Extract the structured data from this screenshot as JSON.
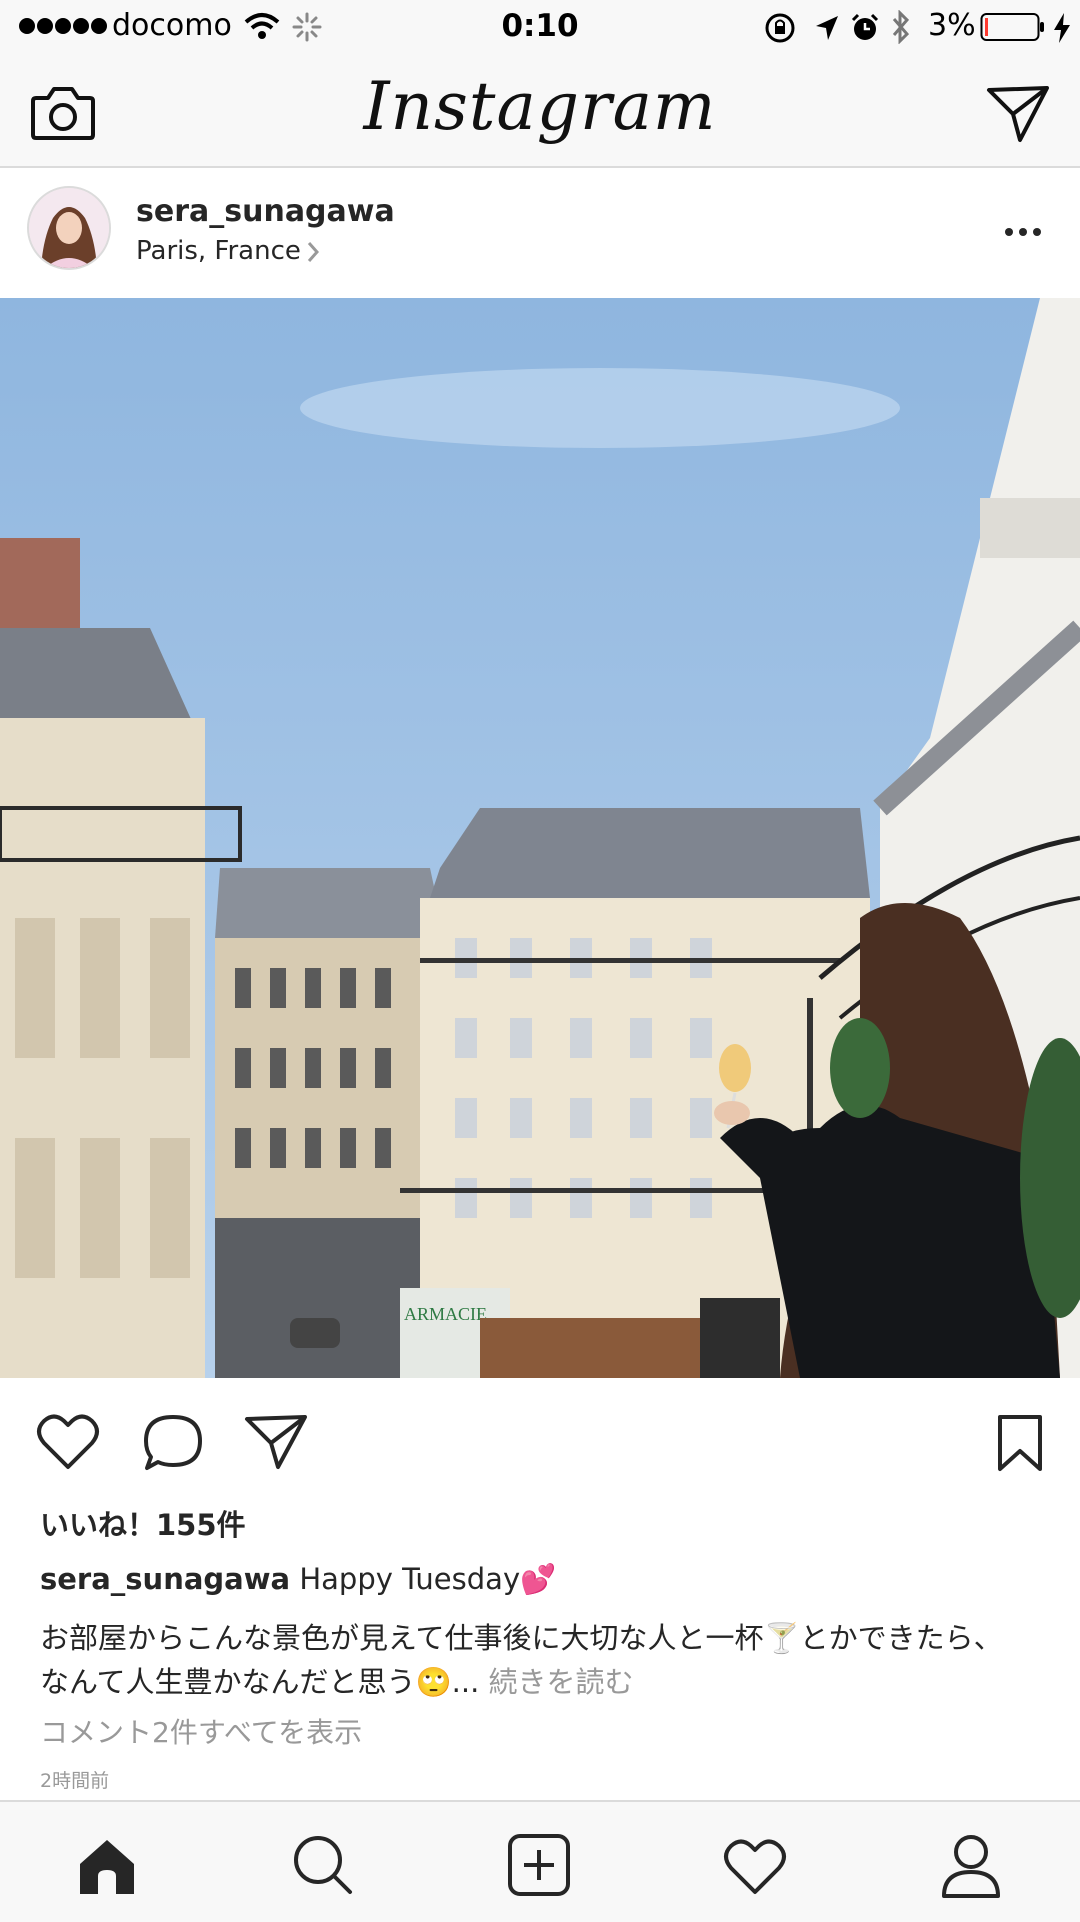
{
  "status_bar": {
    "carrier": "docomo",
    "time": "0:10",
    "battery": "3%"
  },
  "nav": {
    "logo": "Instagram"
  },
  "post": {
    "username": "sera_sunagawa",
    "location": "Paris, France",
    "sign": "ARMACIE",
    "likes": "いいね！155件",
    "caption_user": "sera_sunagawa",
    "caption_line1": "Happy Tuesday💕",
    "caption_line2": "お部屋からこんな景色が見えて仕事後に大切な人と一杯🍸とかできたら、",
    "caption_line3": "なんて人生豊かなんだと思う🙄...",
    "more": "続きを読む",
    "comments": "コメント2件すべてを表示",
    "timestamp": "2時間前"
  },
  "tab_bar": {
    "tabs": [
      "home-icon",
      "search-icon",
      "add-post-icon",
      "activity-heart-icon",
      "profile-icon"
    ]
  },
  "colors": {
    "sky": "#9ec2e6",
    "text": "#262626",
    "muted": "#999999",
    "battery_low": "#ff3b30"
  }
}
